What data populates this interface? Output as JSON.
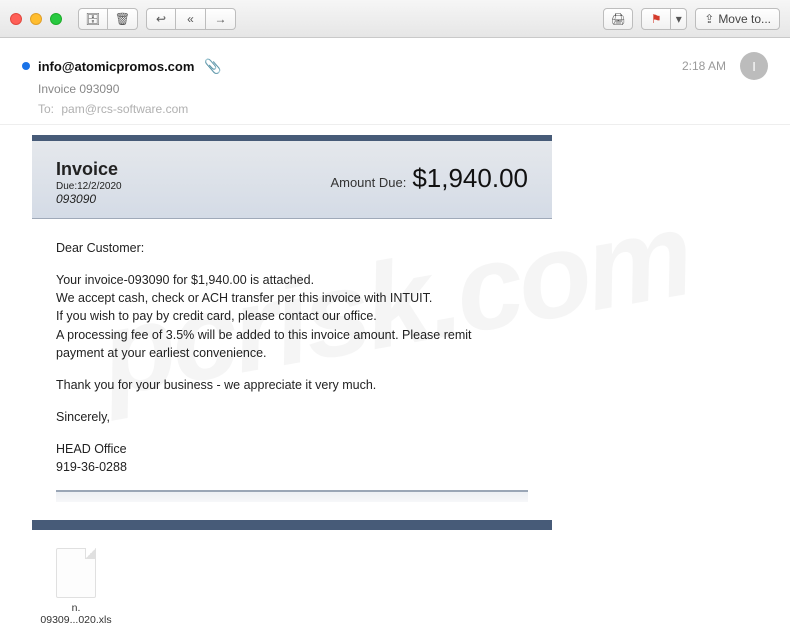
{
  "toolbar": {
    "move_to_label": "Move to..."
  },
  "header": {
    "from": "info@atomicpromos.com",
    "subject": "Invoice 093090",
    "to_label": "To:",
    "to_value": "pam@rcs-software.com",
    "time": "2:18 AM",
    "avatar_initial": "I"
  },
  "invoice": {
    "title": "Invoice",
    "due_label": "Due:12/2/2020",
    "number": "093090",
    "amount_label": "Amount Due:",
    "amount_value": "$1,940.00",
    "greeting": "Dear Customer:",
    "line1": "Your invoice-093090 for $1,940.00 is attached.",
    "line2": "We accept cash, check or ACH transfer per this invoice with INTUIT.",
    "line3": "If you wish to pay by credit card, please contact our office.",
    "line4": "A processing fee of 3.5% will be added to this invoice amount. Please remit",
    "line5": "payment at your earliest convenience.",
    "thanks": "Thank you for your business - we appreciate it very much.",
    "signoff": "Sincerely,",
    "org": "HEAD Office",
    "phone": "919-36-0288"
  },
  "attachment": {
    "line1": "n.",
    "line2": "09309...020.xls"
  },
  "watermark": "pcrisk.com"
}
